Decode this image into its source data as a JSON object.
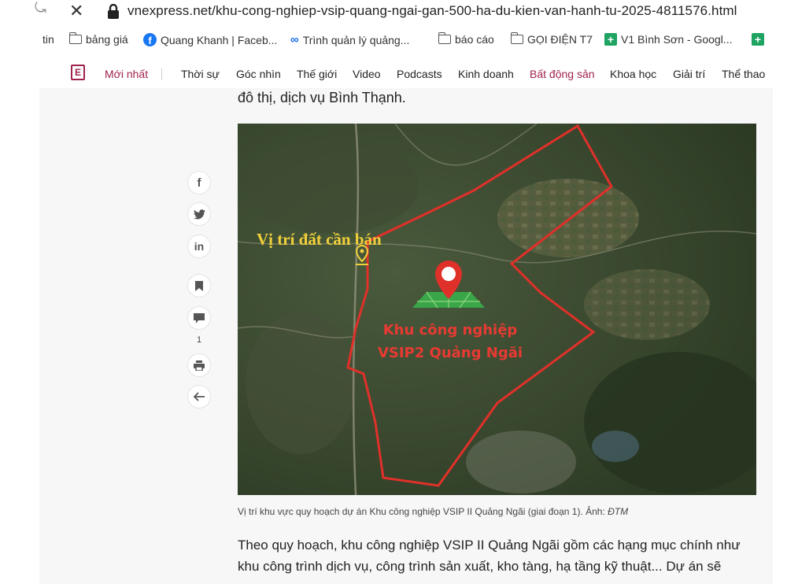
{
  "browser": {
    "url": "vnexpress.net/khu-cong-nghiep-vsip-quang-ngai-gan-500-ha-du-kien-van-hanh-tu-2025-4811576.html"
  },
  "bookmarks": [
    {
      "label": "tin",
      "icon": "none"
    },
    {
      "label": "bảng giá",
      "icon": "folder-icon"
    },
    {
      "label": "Quang Khanh | Faceb...",
      "icon": "facebook-icon"
    },
    {
      "label": "Trình quản lý quảng...",
      "icon": "meta-icon"
    },
    {
      "label": "báo cáo",
      "icon": "folder-icon"
    },
    {
      "label": "GỌI ĐIỆN T7",
      "icon": "folder-icon"
    },
    {
      "label": "V1 Bình Sơn - Googl...",
      "icon": "sheets-icon"
    }
  ],
  "site_nav": {
    "items": [
      "Mới nhất",
      "Thời sự",
      "Góc nhìn",
      "Thế giới",
      "Video",
      "Podcasts",
      "Kinh doanh",
      "Bất động sản",
      "Khoa học",
      "Giải trí",
      "Thể thao"
    ],
    "accent_color": "#9f224e"
  },
  "article": {
    "previous_line": "đô thị, dịch vụ Bình Thạnh.",
    "map_label_land": "Vị trí đất cần bán",
    "map_label_park_line1": "Khu công nghiệp",
    "map_label_park_line2": "VSIP2  Quảng Ngãi",
    "caption": "Vị trí khu vực quy hoạch dự án Khu công nghiệp VSIP II Quảng Ngãi (giai đoạn 1). Ảnh: ",
    "caption_credit": "ĐTM",
    "body_line1": "Theo quy hoạch, khu công nghiệp VSIP II Quảng Ngãi gồm các hạng mục chính như",
    "body_line2": "khu công trình dịch vụ, công trình sản xuất, kho tàng, hạ tầng kỹ thuật... Dự án sẽ"
  },
  "social": {
    "comment_count": "1"
  },
  "colors": {
    "boundary": "#e0302a",
    "land_label": "#f2d03b",
    "park_label": "#e83a33"
  }
}
